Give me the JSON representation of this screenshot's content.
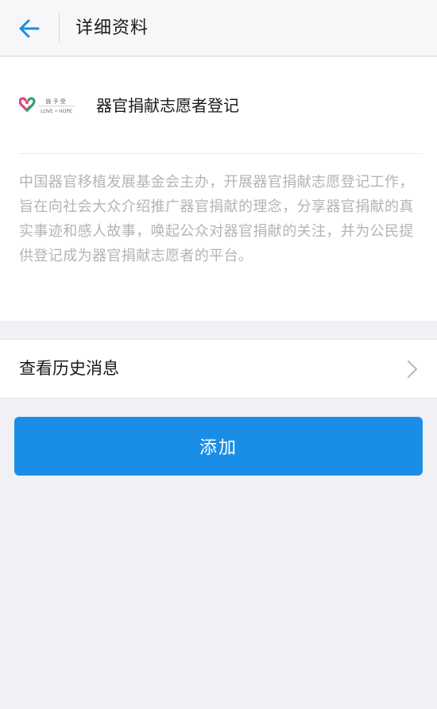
{
  "header": {
    "title": "详细资料",
    "back_icon": "arrow-left-icon"
  },
  "profile": {
    "logo": {
      "icon": "heart-logo-icon",
      "top_text": "施 予 受",
      "bottom_text": "LOVE • HOPE",
      "colors": {
        "heart_pink": "#e0457b",
        "heart_green": "#2ea36b"
      }
    },
    "name": "器官捐献志愿者登记",
    "description": "中国器官移植发展基金会主办，开展器官捐献志愿登记工作，旨在向社会大众介绍推广器官捐献的理念，分享器官捐献的真实事迹和感人故事，唤起公众对器官捐献的关注，并为公民提供登记成为器官捐献志愿者的平台。"
  },
  "history": {
    "label": "查看历史消息",
    "icon": "chevron-right-icon"
  },
  "actions": {
    "add_label": "添加"
  },
  "colors": {
    "accent": "#1a8ee6",
    "background": "#f0f0f5"
  }
}
